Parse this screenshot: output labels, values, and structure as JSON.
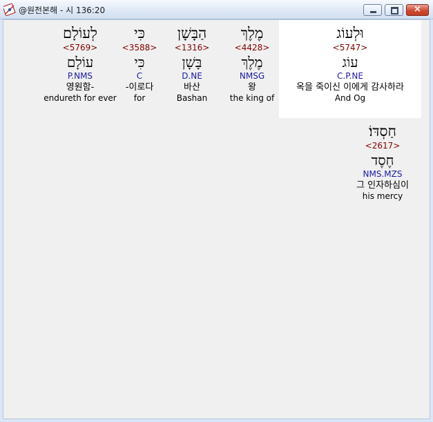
{
  "window": {
    "title": "@원전본해 - 시 136:20",
    "icon": "book-compass-icon",
    "controls": {
      "minimize": "minimize-icon",
      "maximize": "maximize-icon",
      "close": "×"
    },
    "colors": {
      "strong": "#800000",
      "morph": "#1a1aa8",
      "highlight": "#ffffff"
    }
  },
  "words": [
    {
      "hebrew": "וּלְעוֹג",
      "strong": "<5747>",
      "lemma": "עוֹג",
      "morph": "C.P.NE",
      "korean": "옥을 죽이신 이에게 감사하라",
      "english": "And Og",
      "selected": true
    },
    {
      "hebrew": "מֶלֶךְ",
      "strong": "<4428>",
      "lemma": "מֶלֶךְ",
      "morph": "NMSG",
      "korean": "왕",
      "english": "the king of",
      "selected": false
    },
    {
      "hebrew": "הַבָּשָׁן",
      "strong": "<1316>",
      "lemma": "בָּשָׁן",
      "morph": "D.NE",
      "korean": "바산",
      "english": "Bashan",
      "selected": false
    },
    {
      "hebrew": "כִּי",
      "strong": "<3588>",
      "lemma": "כִּי",
      "morph": "C",
      "korean": "-이로다",
      "english": "for",
      "selected": false
    },
    {
      "hebrew": "לְעוֹלָם",
      "strong": "<5769>",
      "lemma": "עוֹלָם",
      "morph": "P.NMS",
      "korean": "영원함-",
      "english": "endureth for ever",
      "selected": false
    },
    {
      "hebrew": "חַסְדּוֹ׃",
      "strong": "<2617>",
      "lemma": "חֶסֶד",
      "morph": "NMS.MZS",
      "korean": "그 인자하심이",
      "english": "his mercy",
      "selected": false
    }
  ]
}
